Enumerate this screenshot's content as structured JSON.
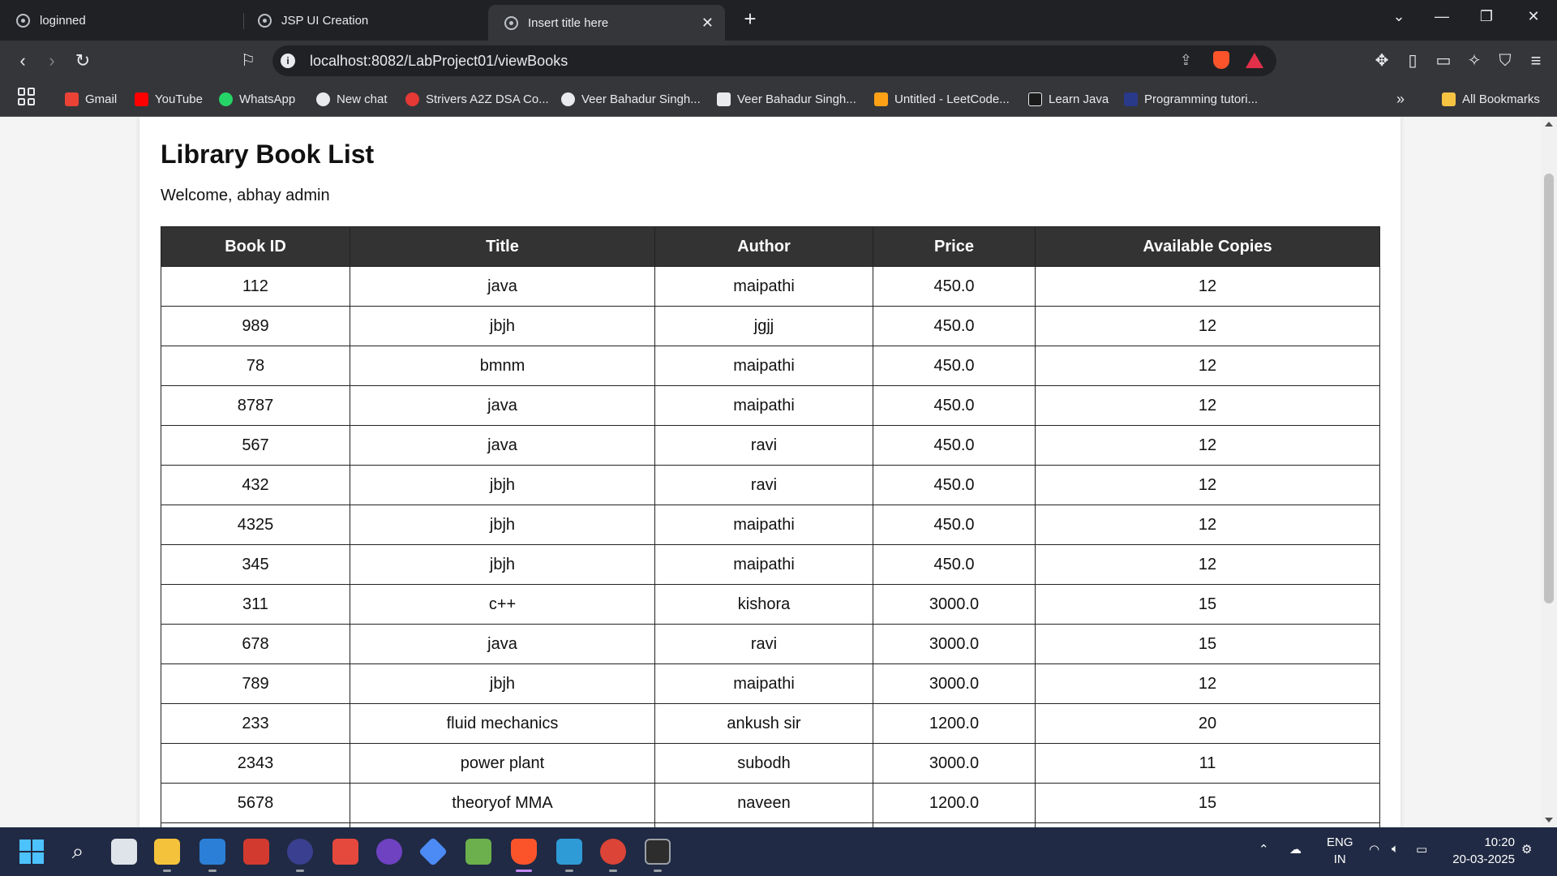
{
  "tabs": [
    {
      "label": "loginned"
    },
    {
      "label": "JSP UI Creation"
    },
    {
      "label": "Insert title here"
    }
  ],
  "address_bar": {
    "url": "localhost:8082/LabProject01/viewBooks"
  },
  "bookmarks": [
    {
      "label": "Gmail",
      "color": "#ea4335"
    },
    {
      "label": "YouTube",
      "color": "#ff0000"
    },
    {
      "label": "WhatsApp",
      "color": "#25d366"
    },
    {
      "label": "New chat",
      "color": "#e8eaed"
    },
    {
      "label": "Strivers A2Z DSA Co...",
      "color": "#e53935"
    },
    {
      "label": "Veer Bahadur Singh...",
      "color": "#e8eaed"
    },
    {
      "label": "Veer Bahadur Singh...",
      "color": "#e8eaed"
    },
    {
      "label": "Untitled - LeetCode...",
      "color": "#ffa116"
    },
    {
      "label": "Learn Java",
      "color": "#1a1a1a"
    },
    {
      "label": "Programming tutori...",
      "color": "#2a3a8a"
    }
  ],
  "all_bookmarks": "All Bookmarks",
  "page": {
    "title": "Library Book List",
    "welcome": "Welcome, abhay admin",
    "columns": [
      "Book ID",
      "Title",
      "Author",
      "Price",
      "Available Copies"
    ],
    "rows": [
      [
        "112",
        "java",
        "maipathi",
        "450.0",
        "12"
      ],
      [
        "989",
        "jbjh",
        "jgjj",
        "450.0",
        "12"
      ],
      [
        "78",
        "bmnm",
        "maipathi",
        "450.0",
        "12"
      ],
      [
        "8787",
        "java",
        "maipathi",
        "450.0",
        "12"
      ],
      [
        "567",
        "java",
        "ravi",
        "450.0",
        "12"
      ],
      [
        "432",
        "jbjh",
        "ravi",
        "450.0",
        "12"
      ],
      [
        "4325",
        "jbjh",
        "maipathi",
        "450.0",
        "12"
      ],
      [
        "345",
        "jbjh",
        "maipathi",
        "450.0",
        "12"
      ],
      [
        "311",
        "c++",
        "kishora",
        "3000.0",
        "15"
      ],
      [
        "678",
        "java",
        "ravi",
        "3000.0",
        "15"
      ],
      [
        "789",
        "jbjh",
        "maipathi",
        "3000.0",
        "12"
      ],
      [
        "233",
        "fluid mechanics",
        "ankush sir",
        "1200.0",
        "20"
      ],
      [
        "2343",
        "power plant",
        "subodh",
        "3000.0",
        "11"
      ],
      [
        "5678",
        "theoryof MMA",
        "naveen",
        "1200.0",
        "15"
      ],
      [
        "",
        "",
        "",
        "",
        ""
      ]
    ]
  },
  "taskbar": {
    "lang": "ENG",
    "region": "IN",
    "time": "10:20",
    "date": "20-03-2025"
  }
}
